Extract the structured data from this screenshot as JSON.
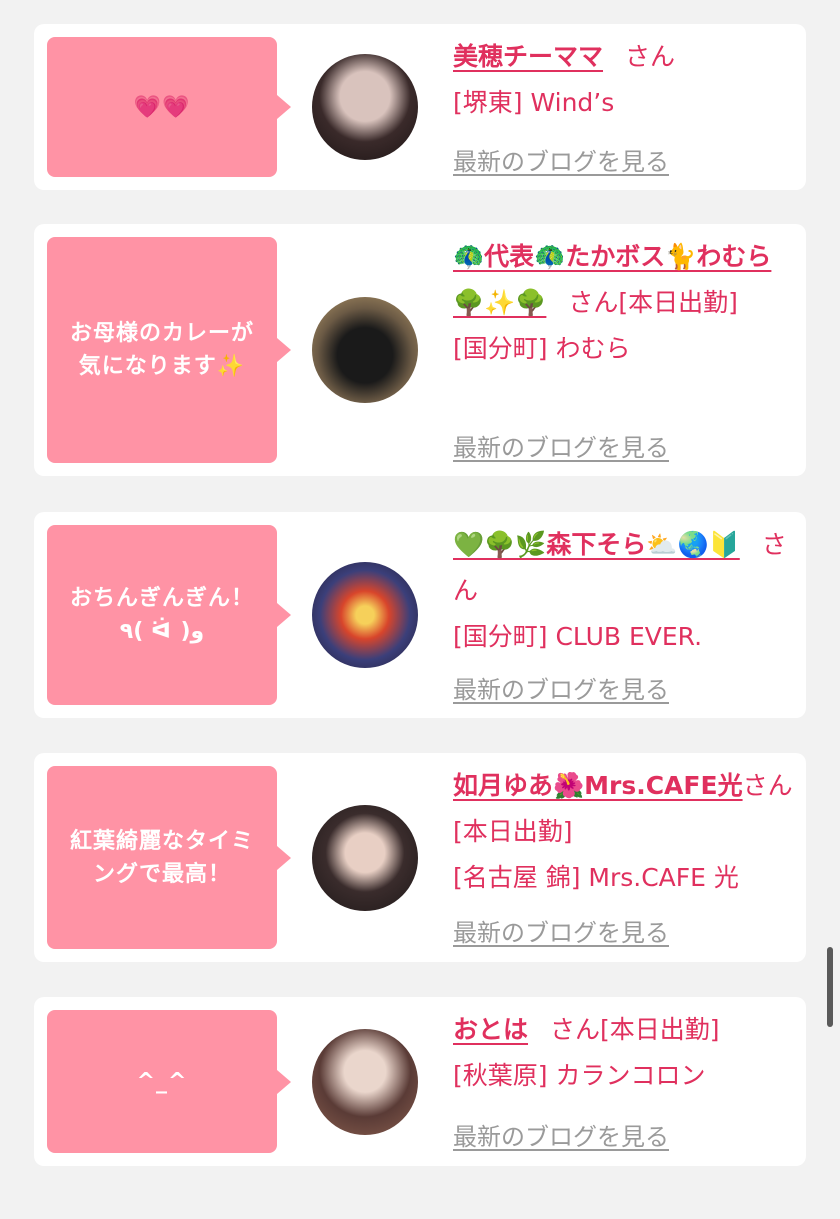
{
  "cards": [
    {
      "comment": "💗💗",
      "name": "美穂チーママ",
      "san": "さん",
      "shop": "[堺東] Wind’s",
      "blog_link": "最新のブログを見る"
    },
    {
      "comment": "お母様のカレーが気になります✨",
      "name": "🦚代表🦚たかボス🐈わむら🌳✨🌳",
      "san": "さん[本日出勤]",
      "shop": "[国分町] わむら",
      "blog_link": "最新のブログを見る"
    },
    {
      "comment": "おちんぎんぎん！ ٩( ᐛ )و",
      "name": "💚🌳🌿森下そら⛅🌏🔰",
      "san": "さん",
      "shop": "[国分町] CLUB EVER.",
      "blog_link": "最新のブログを見る"
    },
    {
      "comment": "紅葉綺麗なタイミングで最高！",
      "name": "如月ゆあ🌺Mrs.CAFE光",
      "san": "さん[本日出勤]",
      "shop": "[名古屋 錦] Mrs.CAFE 光",
      "blog_link": "最新のブログを見る"
    },
    {
      "comment": "^_^",
      "name": "おとは",
      "san": "さん[本日出勤]",
      "shop": "[秋葉原] カランコロン",
      "blog_link": "最新のブログを見る"
    }
  ]
}
